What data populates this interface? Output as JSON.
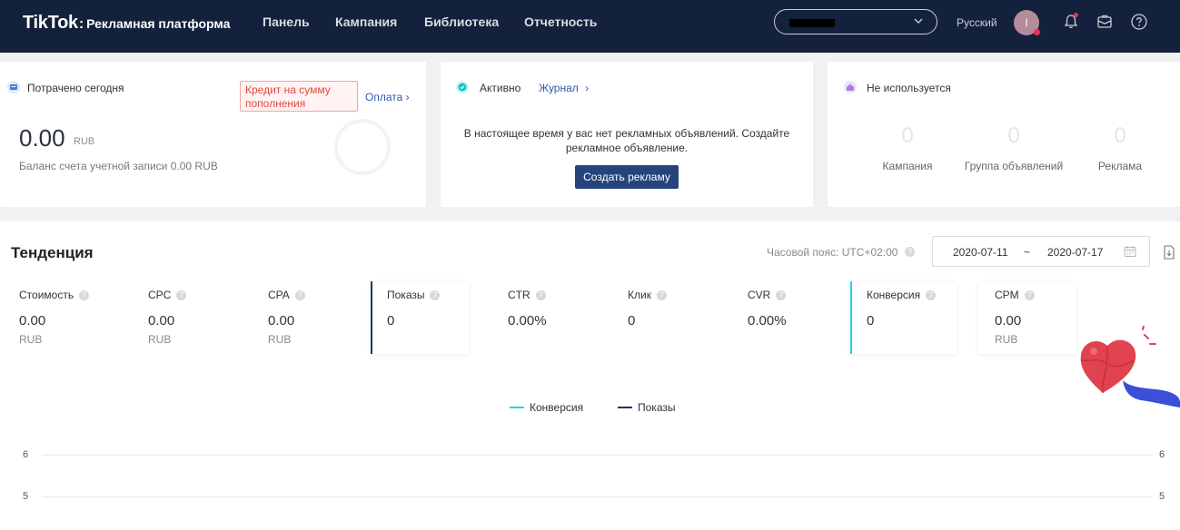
{
  "header": {
    "logo_main": "TikTok",
    "logo_sep": ":",
    "logo_sub": "Рекламная платформа",
    "nav": [
      "Панель",
      "Кампания",
      "Библиотека",
      "Отчетность"
    ],
    "language": "Русский",
    "avatar_initial": "I"
  },
  "spent_card": {
    "title": "Потрачено сегодня",
    "credit_badge": "Кредит на сумму пополнения",
    "pay_link": "Оплата",
    "value": "0.00",
    "unit": "RUB",
    "balance": "Баланс счета учетной записи 0.00 RUB"
  },
  "active_card": {
    "title": "Активно",
    "journal_link": "Журнал",
    "message": "В настоящее время у вас нет рекламных объявлений. Создайте рекламное объявление.",
    "create_button": "Создать рекламу"
  },
  "unused_card": {
    "title": "Не используется",
    "stats": [
      {
        "value": "0",
        "label": "Кампания"
      },
      {
        "value": "0",
        "label": "Группа объявлений"
      },
      {
        "value": "0",
        "label": "Реклама"
      }
    ]
  },
  "trend": {
    "title": "Тенденция",
    "timezone": "Часовой пояс: UTC+02:00",
    "date_start": "2020-07-11",
    "date_sep": "~",
    "date_end": "2020-07-17",
    "metrics": [
      {
        "label": "Стоимость",
        "value": "0.00",
        "unit": "RUB"
      },
      {
        "label": "CPC",
        "value": "0.00",
        "unit": "RUB"
      },
      {
        "label": "CPA",
        "value": "0.00",
        "unit": "RUB"
      },
      {
        "label": "Показы",
        "value": "0",
        "unit": ""
      },
      {
        "label": "CTR",
        "value": "0.00%",
        "unit": ""
      },
      {
        "label": "Клик",
        "value": "0",
        "unit": ""
      },
      {
        "label": "CVR",
        "value": "0.00%",
        "unit": ""
      },
      {
        "label": "Конверсия",
        "value": "0",
        "unit": ""
      },
      {
        "label": "CPM",
        "value": "0.00",
        "unit": "RUB"
      }
    ],
    "legend": [
      {
        "name": "Конверсия",
        "color": "#25d4e0"
      },
      {
        "name": "Показы",
        "color": "#1f3566"
      }
    ],
    "y_ticks": [
      "6",
      "5"
    ]
  },
  "colors": {
    "topbar": "#13213c",
    "accent": "#26447c",
    "credit": "#e2473f"
  }
}
